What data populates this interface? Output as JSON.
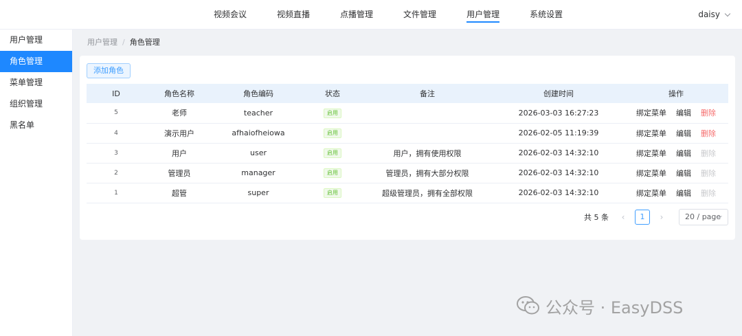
{
  "topnav": {
    "items": [
      {
        "label": "视频会议"
      },
      {
        "label": "视频直播"
      },
      {
        "label": "点播管理"
      },
      {
        "label": "文件管理"
      },
      {
        "label": "用户管理",
        "active": true
      },
      {
        "label": "系统设置"
      }
    ],
    "user": "daisy"
  },
  "sidebar": {
    "items": [
      {
        "label": "用户管理"
      },
      {
        "label": "角色管理",
        "active": true
      },
      {
        "label": "菜单管理"
      },
      {
        "label": "组织管理"
      },
      {
        "label": "黑名单"
      }
    ]
  },
  "breadcrumb": {
    "parent": "用户管理",
    "separator": "/",
    "current": "角色管理"
  },
  "toolbar": {
    "add_label": "添加角色"
  },
  "table": {
    "headers": [
      "ID",
      "角色名称",
      "角色编码",
      "状态",
      "备注",
      "创建时间",
      "操作"
    ],
    "rows": [
      {
        "id": "5",
        "name": "老师",
        "code": "teacher",
        "status": "启用",
        "remark": "",
        "created": "2026-03-03 16:27:23",
        "bind": "绑定菜单",
        "edit": "编辑",
        "delete": "删除",
        "deletable": true
      },
      {
        "id": "4",
        "name": "演示用户",
        "code": "afhaiofheiowa",
        "status": "启用",
        "remark": "",
        "created": "2026-02-05 11:19:39",
        "bind": "绑定菜单",
        "edit": "编辑",
        "delete": "删除",
        "deletable": true
      },
      {
        "id": "3",
        "name": "用户",
        "code": "user",
        "status": "启用",
        "remark": "用户，拥有使用权限",
        "created": "2026-02-03 14:32:10",
        "bind": "绑定菜单",
        "edit": "编辑",
        "delete": "删除",
        "deletable": false
      },
      {
        "id": "2",
        "name": "管理员",
        "code": "manager",
        "status": "启用",
        "remark": "管理员，拥有大部分权限",
        "created": "2026-02-03 14:32:10",
        "bind": "绑定菜单",
        "edit": "编辑",
        "delete": "删除",
        "deletable": false
      },
      {
        "id": "1",
        "name": "超管",
        "code": "super",
        "status": "启用",
        "remark": "超级管理员，拥有全部权限",
        "created": "2026-02-03 14:32:10",
        "bind": "绑定菜单",
        "edit": "编辑",
        "delete": "删除",
        "deletable": false
      }
    ]
  },
  "pagination": {
    "total": "共 5 条",
    "current_page": "1",
    "page_size": "20 / page"
  },
  "watermark": {
    "text": "公众号 · EasyDSS"
  },
  "colors": {
    "primary": "#1e88ff",
    "danger": "#f56c6c",
    "success": "#67c23a",
    "disabled": "#c8c9cc"
  }
}
